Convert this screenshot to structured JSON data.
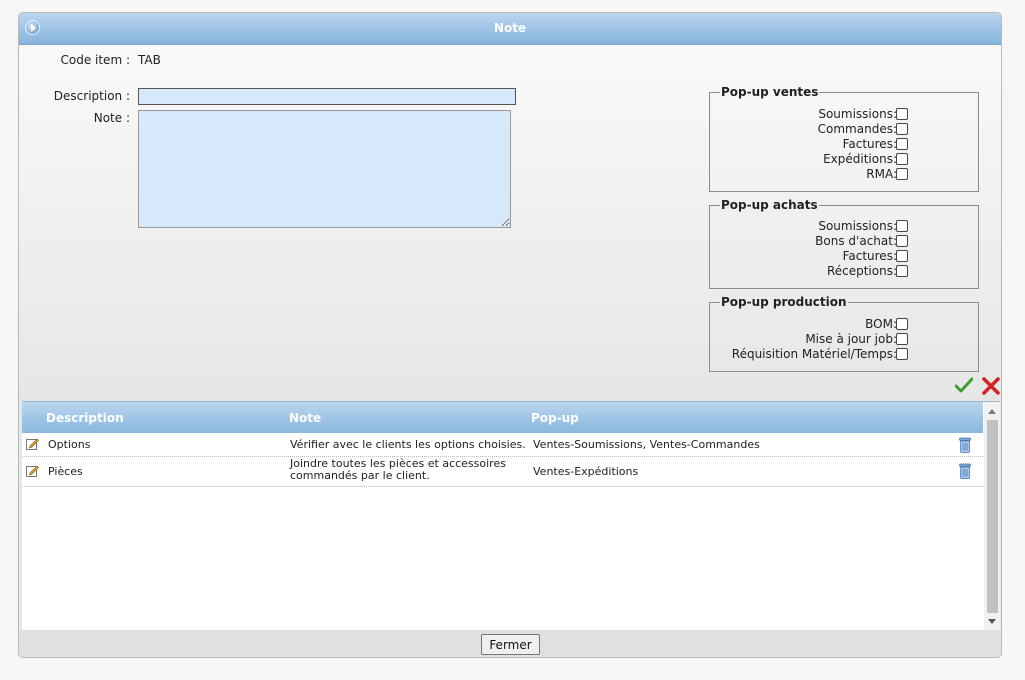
{
  "window": {
    "title": "Note"
  },
  "form": {
    "code_label": "Code item :",
    "code_value": "TAB",
    "description_label": "Description :",
    "description_value": "",
    "note_label": "Note :",
    "note_value": ""
  },
  "popup_ventes": {
    "legend": "Pop-up ventes",
    "options": [
      {
        "label": "Soumissions:",
        "checked": false
      },
      {
        "label": "Commandes:",
        "checked": false
      },
      {
        "label": "Factures:",
        "checked": false
      },
      {
        "label": "Expéditions:",
        "checked": false
      },
      {
        "label": "RMA:",
        "checked": false
      }
    ]
  },
  "popup_achats": {
    "legend": "Pop-up achats",
    "options": [
      {
        "label": "Soumissions:",
        "checked": false
      },
      {
        "label": "Bons d'achat:",
        "checked": false
      },
      {
        "label": "Factures:",
        "checked": false
      },
      {
        "label": "Réceptions:",
        "checked": false
      }
    ]
  },
  "popup_production": {
    "legend": "Pop-up production",
    "options": [
      {
        "label": "BOM:",
        "checked": false
      },
      {
        "label": "Mise à jour job:",
        "checked": false
      },
      {
        "label": "Réquisition Matériel/Temps:",
        "checked": false
      }
    ]
  },
  "grid": {
    "columns": [
      "Description",
      "Note",
      "Pop-up"
    ],
    "rows": [
      {
        "description": "Options",
        "note": "Vérifier avec le clients les options choisies.",
        "popup": "Ventes-Soumissions, Ventes-Commandes"
      },
      {
        "description": "Pièces",
        "note": "Joindre toutes les pièces et accessoires commandés par le client.",
        "popup": "Ventes-Expéditions"
      }
    ]
  },
  "footer": {
    "close_label": "Fermer"
  },
  "icons": {
    "title": "navigate-arrow-icon",
    "ok": "checkmark-icon",
    "cancel": "red-x-icon",
    "edit": "pencil-icon",
    "delete": "trash-can-icon"
  },
  "colors": {
    "header_blue": "#9ec4e6",
    "input_bg": "#d8e8fc",
    "ok_green": "#3aa02a",
    "cancel_red": "#d42020"
  }
}
